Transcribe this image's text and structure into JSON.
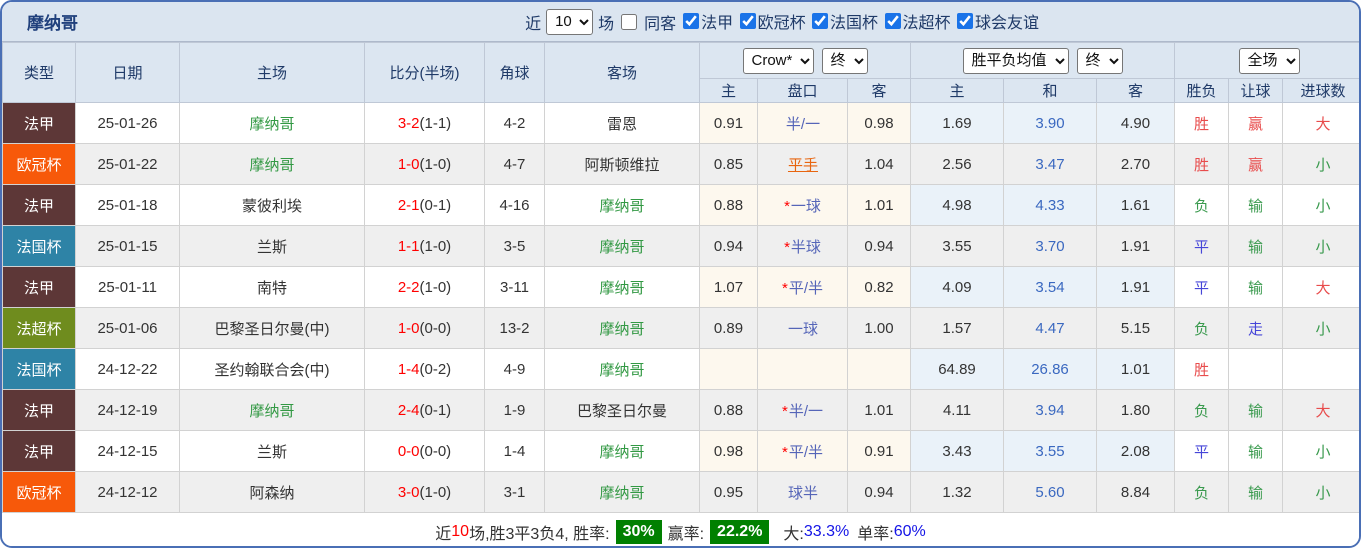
{
  "window": {
    "title": "摩纳哥"
  },
  "filters": {
    "near_label": "近",
    "near_value": "10",
    "matches_label": "场",
    "same_venue_label": "同客",
    "same_venue_checked": false,
    "leagues": [
      {
        "label": "法甲",
        "checked": true
      },
      {
        "label": "欧冠杯",
        "checked": true
      },
      {
        "label": "法国杯",
        "checked": true
      },
      {
        "label": "法超杯",
        "checked": true
      },
      {
        "label": "球会友谊",
        "checked": true
      }
    ]
  },
  "table": {
    "static_headers": [
      "类型",
      "日期",
      "主场",
      "比分(半场)",
      "角球",
      "客场"
    ],
    "selects": {
      "bookmaker": "Crow*",
      "bookmaker_time": "终",
      "avg": "胜平负均值",
      "avg_time": "终",
      "scope": "全场"
    },
    "sub_headers": [
      "主",
      "盘口",
      "客",
      "主",
      "和",
      "客",
      "胜负",
      "让球",
      "进球数"
    ],
    "type_colors": {
      "法甲": "#5d3737",
      "欧冠杯": "#f7590a",
      "法国杯": "#2e83a6",
      "法超杯": "#6f8c1e"
    },
    "highlight_team": "摩纳哥",
    "highlight_color": "#339944",
    "rows": [
      {
        "type": "法甲",
        "date": "25-01-26",
        "home": "摩纳哥",
        "score": "3-2",
        "half": "(1-1)",
        "corners": "4-2",
        "away": "雷恩",
        "odds_home": "0.91",
        "handicap": "半/一",
        "star": false,
        "push": false,
        "odds_away": "0.98",
        "avg_home": "1.69",
        "avg_draw": "3.90",
        "avg_away": "4.90",
        "r_wdl": [
          "胜",
          "r"
        ],
        "r_ah": [
          "赢",
          "r"
        ],
        "r_ou": [
          "大",
          "r"
        ]
      },
      {
        "type": "欧冠杯",
        "date": "25-01-22",
        "home": "摩纳哥",
        "score": "1-0",
        "half": "(1-0)",
        "corners": "4-7",
        "away": "阿斯顿维拉",
        "odds_home": "0.85",
        "handicap": "平手",
        "star": false,
        "push": true,
        "odds_away": "1.04",
        "avg_home": "2.56",
        "avg_draw": "3.47",
        "avg_away": "2.70",
        "r_wdl": [
          "胜",
          "r"
        ],
        "r_ah": [
          "赢",
          "r"
        ],
        "r_ou": [
          "小",
          "g"
        ]
      },
      {
        "type": "法甲",
        "date": "25-01-18",
        "home": "蒙彼利埃",
        "score": "2-1",
        "half": "(0-1)",
        "corners": "4-16",
        "away": "摩纳哥",
        "odds_home": "0.88",
        "handicap": "一球",
        "star": true,
        "push": false,
        "odds_away": "1.01",
        "avg_home": "4.98",
        "avg_draw": "4.33",
        "avg_away": "1.61",
        "r_wdl": [
          "负",
          "g"
        ],
        "r_ah": [
          "输",
          "g"
        ],
        "r_ou": [
          "小",
          "g"
        ]
      },
      {
        "type": "法国杯",
        "date": "25-01-15",
        "home": "兰斯",
        "score": "1-1",
        "half": "(1-0)",
        "corners": "3-5",
        "away": "摩纳哥",
        "odds_home": "0.94",
        "handicap": "半球",
        "star": true,
        "push": false,
        "odds_away": "0.94",
        "avg_home": "3.55",
        "avg_draw": "3.70",
        "avg_away": "1.91",
        "r_wdl": [
          "平",
          "b"
        ],
        "r_ah": [
          "输",
          "g"
        ],
        "r_ou": [
          "小",
          "g"
        ]
      },
      {
        "type": "法甲",
        "date": "25-01-11",
        "home": "南特",
        "score": "2-2",
        "half": "(1-0)",
        "corners": "3-11",
        "away": "摩纳哥",
        "odds_home": "1.07",
        "handicap": "平/半",
        "star": true,
        "push": false,
        "odds_away": "0.82",
        "avg_home": "4.09",
        "avg_draw": "3.54",
        "avg_away": "1.91",
        "r_wdl": [
          "平",
          "b"
        ],
        "r_ah": [
          "输",
          "g"
        ],
        "r_ou": [
          "大",
          "r"
        ]
      },
      {
        "type": "法超杯",
        "date": "25-01-06",
        "home": "巴黎圣日尔曼(中)",
        "score": "1-0",
        "half": "(0-0)",
        "corners": "13-2",
        "away": "摩纳哥",
        "odds_home": "0.89",
        "handicap": "一球",
        "star": false,
        "push": false,
        "odds_away": "1.00",
        "avg_home": "1.57",
        "avg_draw": "4.47",
        "avg_away": "5.15",
        "r_wdl": [
          "负",
          "g"
        ],
        "r_ah": [
          "走",
          "b"
        ],
        "r_ou": [
          "小",
          "g"
        ]
      },
      {
        "type": "法国杯",
        "date": "24-12-22",
        "home": "圣约翰联合会(中)",
        "score": "1-4",
        "half": "(0-2)",
        "corners": "4-9",
        "away": "摩纳哥",
        "odds_home": "",
        "handicap": "",
        "star": false,
        "push": false,
        "odds_away": "",
        "avg_home": "64.89",
        "avg_draw": "26.86",
        "avg_away": "1.01",
        "r_wdl": [
          "胜",
          "r"
        ],
        "r_ah": [
          "",
          ""
        ],
        "r_ou": [
          "",
          ""
        ]
      },
      {
        "type": "法甲",
        "date": "24-12-19",
        "home": "摩纳哥",
        "score": "2-4",
        "half": "(0-1)",
        "corners": "1-9",
        "away": "巴黎圣日尔曼",
        "odds_home": "0.88",
        "handicap": "半/一",
        "star": true,
        "push": false,
        "odds_away": "1.01",
        "avg_home": "4.11",
        "avg_draw": "3.94",
        "avg_away": "1.80",
        "r_wdl": [
          "负",
          "g"
        ],
        "r_ah": [
          "输",
          "g"
        ],
        "r_ou": [
          "大",
          "r"
        ]
      },
      {
        "type": "法甲",
        "date": "24-12-15",
        "home": "兰斯",
        "score": "0-0",
        "half": "(0-0)",
        "corners": "1-4",
        "away": "摩纳哥",
        "odds_home": "0.98",
        "handicap": "平/半",
        "star": true,
        "push": false,
        "odds_away": "0.91",
        "avg_home": "3.43",
        "avg_draw": "3.55",
        "avg_away": "2.08",
        "r_wdl": [
          "平",
          "b"
        ],
        "r_ah": [
          "输",
          "g"
        ],
        "r_ou": [
          "小",
          "g"
        ]
      },
      {
        "type": "欧冠杯",
        "date": "24-12-12",
        "home": "阿森纳",
        "score": "3-0",
        "half": "(1-0)",
        "corners": "3-1",
        "away": "摩纳哥",
        "odds_home": "0.95",
        "handicap": "球半",
        "star": false,
        "push": false,
        "odds_away": "0.94",
        "avg_home": "1.32",
        "avg_draw": "5.60",
        "avg_away": "8.84",
        "r_wdl": [
          "负",
          "g"
        ],
        "r_ah": [
          "输",
          "g"
        ],
        "r_ou": [
          "小",
          "g"
        ]
      }
    ]
  },
  "footer": {
    "prefix": "近",
    "count": "10",
    "mid": "场,胜3平3负4, 胜率:",
    "win_rate": "30%",
    "handicap_label": "赢率:",
    "handicap_rate": "22.2%",
    "big_label": "大:",
    "big_rate": "33.3%",
    "single_label": "单率:",
    "single_rate": "60%",
    "badge_color": "#008000"
  }
}
